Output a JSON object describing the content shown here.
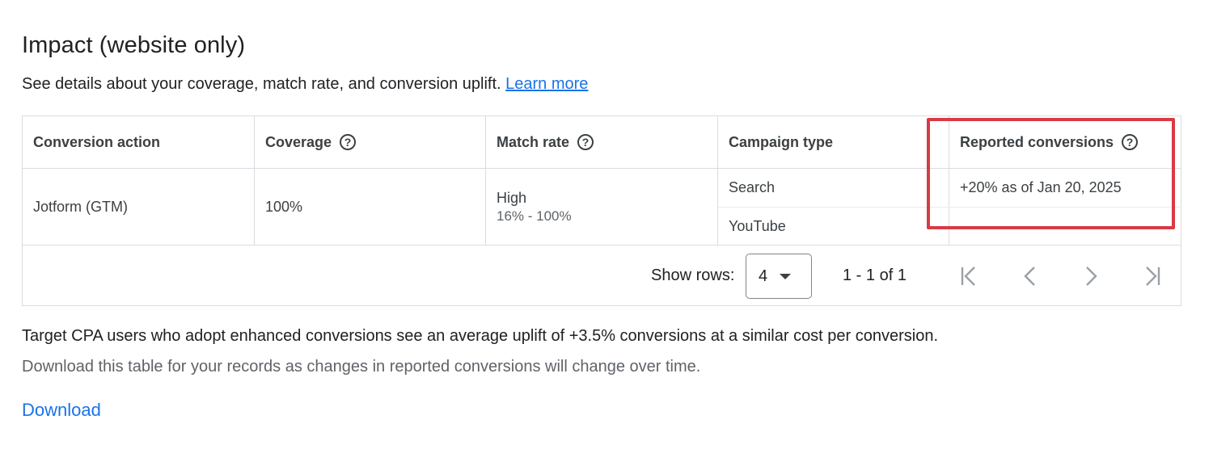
{
  "header": {
    "title": "Impact (website only)",
    "description": "See details about your coverage, match rate, and conversion uplift.",
    "learn_more": "Learn more"
  },
  "table": {
    "columns": [
      "Conversion action",
      "Coverage",
      "Match rate",
      "Campaign type",
      "Reported conversions"
    ],
    "row": {
      "conversion_action": "Jotform (GTM)",
      "coverage": "100%",
      "match_rate": "High",
      "match_rate_range": "16% - 100%",
      "campaign_types": [
        "Search",
        "YouTube"
      ],
      "reported_conversions": [
        "+20% as of Jan 20, 2025",
        "-"
      ]
    },
    "pagination": {
      "show_rows_label": "Show rows:",
      "rows_value": "4",
      "range_text": "1 - 1 of 1"
    }
  },
  "notes": {
    "uplift": "Target CPA users who adopt enhanced conversions see an average uplift of +3.5% conversions at a similar cost per conversion.",
    "download_hint": "Download this table for your records as changes in reported conversions will change over time."
  },
  "download_label": "Download",
  "colors": {
    "link": "#1a73e8",
    "highlight": "#d93a45",
    "border": "#dadce0"
  },
  "icons": [
    "help-icon",
    "first-page-icon",
    "previous-page-icon",
    "next-page-icon",
    "last-page-icon",
    "dropdown-caret-icon"
  ]
}
